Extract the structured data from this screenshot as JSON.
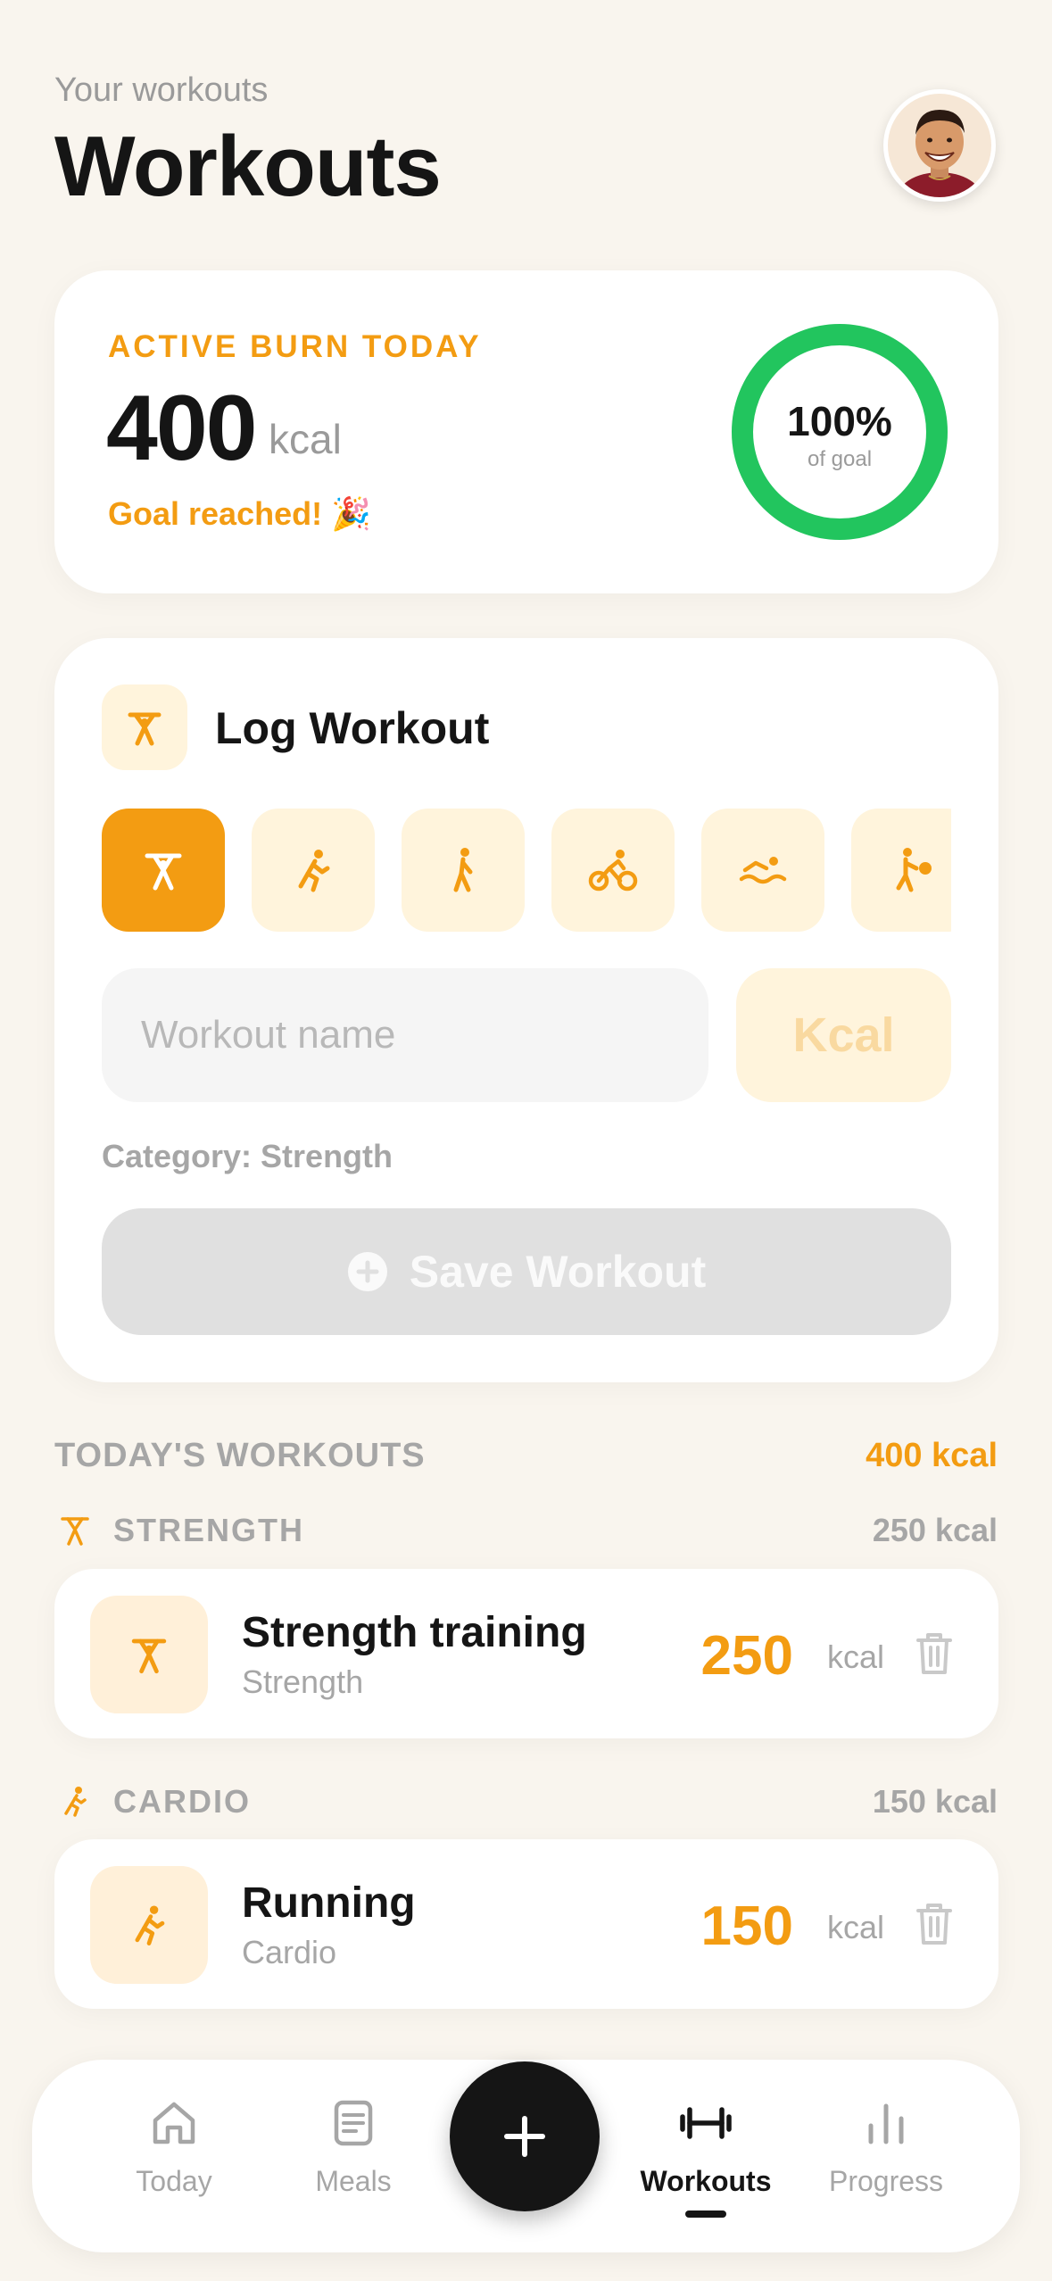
{
  "header": {
    "subtitle": "Your workouts",
    "title": "Workouts"
  },
  "burn": {
    "label": "ACTIVE BURN TODAY",
    "value": "400",
    "unit": "kcal",
    "note": "Goal reached! 🎉",
    "progress_percent": 100,
    "ring_label": "100%",
    "ring_sub": "of goal",
    "ring_color": "#22c55e"
  },
  "log": {
    "title": "Log Workout",
    "categories": [
      {
        "name": "strength",
        "icon": "weightlifter-icon",
        "active": true
      },
      {
        "name": "cardio",
        "icon": "runner-icon",
        "active": false
      },
      {
        "name": "walking",
        "icon": "walker-icon",
        "active": false
      },
      {
        "name": "cycling",
        "icon": "bicycle-icon",
        "active": false
      },
      {
        "name": "swimming",
        "icon": "swimmer-icon",
        "active": false
      },
      {
        "name": "sports",
        "icon": "ball-player-icon",
        "active": false
      }
    ],
    "name_placeholder": "Workout name",
    "kcal_placeholder": "Kcal",
    "category_text": "Category: Strength",
    "save_label": "Save Workout"
  },
  "today": {
    "title": "TODAY'S WORKOUTS",
    "total": "400 kcal",
    "groups": [
      {
        "label": "STRENGTH",
        "total": "250 kcal",
        "icon": "weightlifter-icon",
        "items": [
          {
            "name": "Strength training",
            "category": "Strength",
            "kcal": "250",
            "unit": "kcal"
          }
        ]
      },
      {
        "label": "CARDIO",
        "total": "150 kcal",
        "icon": "runner-icon",
        "items": [
          {
            "name": "Running",
            "category": "Cardio",
            "kcal": "150",
            "unit": "kcal"
          }
        ]
      }
    ]
  },
  "nav": {
    "items": [
      {
        "label": "Today",
        "icon": "home-icon"
      },
      {
        "label": "Meals",
        "icon": "document-icon"
      },
      {
        "label": "Workouts",
        "icon": "dumbbell-icon",
        "active": true
      },
      {
        "label": "Progress",
        "icon": "bar-chart-icon"
      }
    ],
    "fab_icon": "plus-icon"
  },
  "colors": {
    "accent": "#f39c12",
    "background": "#f9f5ee",
    "success": "#22c55e"
  }
}
